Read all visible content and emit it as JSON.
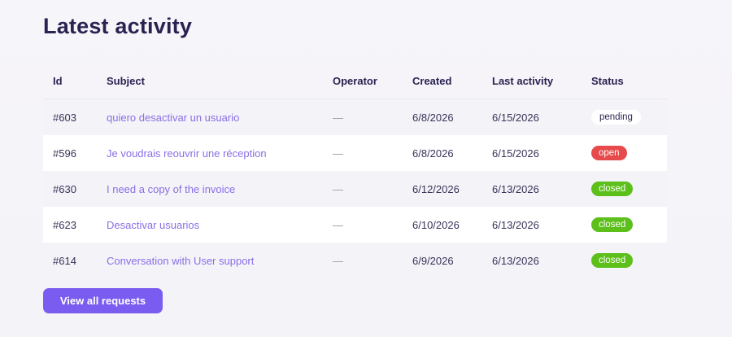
{
  "page": {
    "title": "Latest activity"
  },
  "table": {
    "headers": {
      "id": "Id",
      "subject": "Subject",
      "operator": "Operator",
      "created": "Created",
      "last_activity": "Last activity",
      "status": "Status"
    },
    "rows": [
      {
        "id": "#603",
        "subject": "quiero desactivar un usuario",
        "operator": "—",
        "created": "6/8/2026",
        "last_activity": "6/15/2026",
        "status": "pending"
      },
      {
        "id": "#596",
        "subject": "Je voudrais reouvrir une réception",
        "operator": "—",
        "created": "6/8/2026",
        "last_activity": "6/15/2026",
        "status": "open"
      },
      {
        "id": "#630",
        "subject": "I need a copy of the invoice",
        "operator": "—",
        "created": "6/12/2026",
        "last_activity": "6/13/2026",
        "status": "closed"
      },
      {
        "id": "#623",
        "subject": "Desactivar usuarios",
        "operator": "—",
        "created": "6/10/2026",
        "last_activity": "6/13/2026",
        "status": "closed"
      },
      {
        "id": "#614",
        "subject": "Conversation with User support",
        "operator": "—",
        "created": "6/9/2026",
        "last_activity": "6/13/2026",
        "status": "closed"
      }
    ]
  },
  "footer": {
    "view_all_label": "View all requests"
  },
  "colors": {
    "accent": "#7b5cf0",
    "link": "#8a6ee6",
    "status_open": "#e64a4a",
    "status_closed": "#5cbf1a",
    "status_pending_bg": "#ffffff"
  }
}
